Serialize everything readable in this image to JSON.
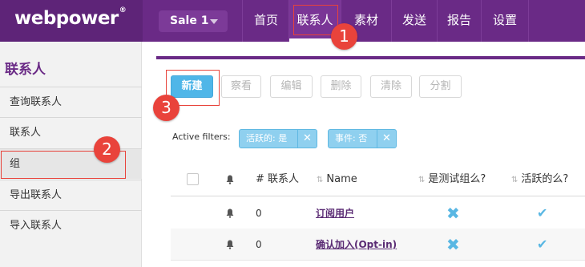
{
  "brand": {
    "logo_text": "webpower",
    "logo_mark": "®"
  },
  "top_nav": {
    "account_dropdown": "Sale 1",
    "items": [
      {
        "label": "首页"
      },
      {
        "label": "联系人"
      },
      {
        "label": "素材"
      },
      {
        "label": "发送"
      },
      {
        "label": "报告"
      },
      {
        "label": "设置"
      }
    ],
    "active_index": 1
  },
  "sidebar": {
    "title": "联系人",
    "items": [
      {
        "label": "查询联系人"
      },
      {
        "label": "联系人"
      },
      {
        "label": "组"
      },
      {
        "label": "导出联系人"
      },
      {
        "label": "导入联系人"
      }
    ],
    "active_index": 2
  },
  "toolbar": {
    "new_label": "新建",
    "view_label": "察看",
    "edit_label": "编辑",
    "delete_label": "删除",
    "clear_label": "清除",
    "split_label": "分割"
  },
  "filters": {
    "label": "Active filters:",
    "chips": [
      {
        "text": "活跃的: 是",
        "close": "✕"
      },
      {
        "text": "事件: 否",
        "close": "✕"
      }
    ]
  },
  "table": {
    "headers": {
      "contacts": "# 联系人",
      "name": "Name",
      "is_test": "是测试组么?",
      "is_active": "活跃的么?"
    },
    "rows": [
      {
        "contacts": "0",
        "name": "订阅用户",
        "is_test": "✖",
        "is_active": "✔"
      },
      {
        "contacts": "0",
        "name": "确认加入(Opt-in)",
        "is_test": "✖",
        "is_active": "✔"
      }
    ]
  },
  "annotations": {
    "step1": "1",
    "step2": "2",
    "step3": "3",
    "color": "#e9433b"
  },
  "colors": {
    "brand_purple": "#6a2a86",
    "primary_button": "#4fb6e8",
    "filter_chip": "#8fd0ef",
    "status_icon": "#59b7e3"
  }
}
